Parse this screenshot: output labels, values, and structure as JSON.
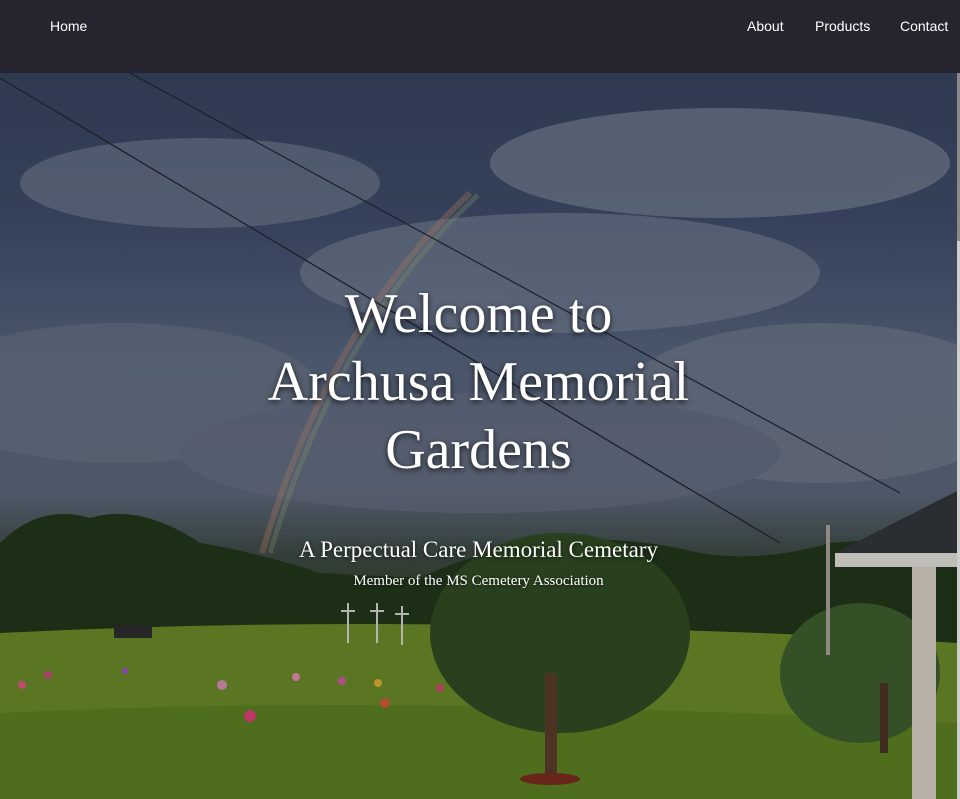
{
  "nav": {
    "home": "Home",
    "about": "About",
    "products": "Products",
    "contact": "Contact"
  },
  "hero": {
    "title_lines": [
      "Welcome to",
      "Archusa Memorial",
      "Gardens"
    ],
    "subtitle": "A Perpectual Care Memorial Cemetary",
    "member": "Member of the MS Cemetery Association"
  },
  "colors": {
    "navbar": "#26252f",
    "text": "#ffffff"
  }
}
